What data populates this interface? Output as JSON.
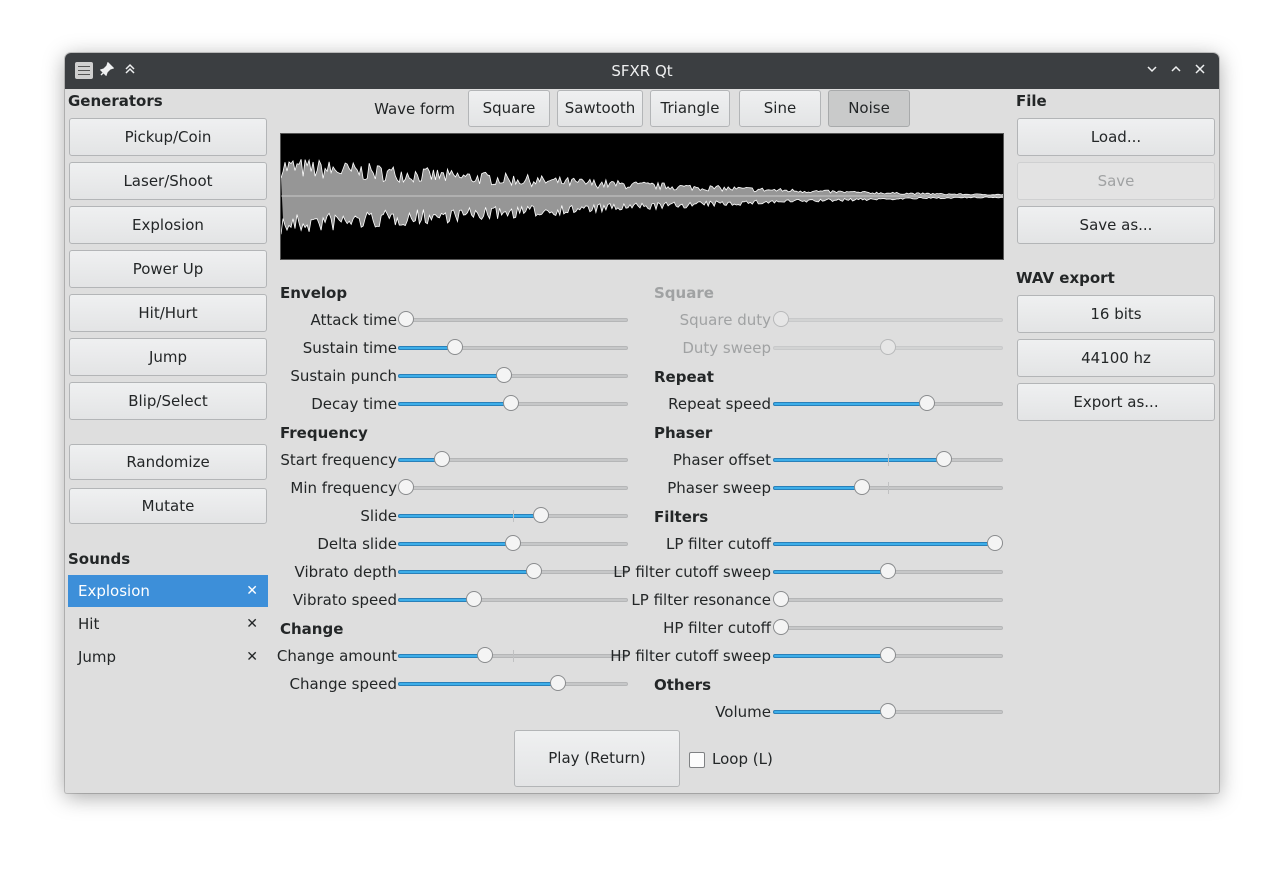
{
  "window": {
    "title": "SFXR Qt"
  },
  "generators": {
    "header": "Generators",
    "buttons": [
      "Pickup/Coin",
      "Laser/Shoot",
      "Explosion",
      "Power Up",
      "Hit/Hurt",
      "Jump",
      "Blip/Select"
    ],
    "randomize": "Randomize",
    "mutate": "Mutate"
  },
  "sounds": {
    "header": "Sounds",
    "items": [
      {
        "name": "Explosion",
        "selected": true
      },
      {
        "name": "Hit",
        "selected": false
      },
      {
        "name": "Jump",
        "selected": false
      }
    ],
    "remove_glyph": "✕"
  },
  "waveform": {
    "label": "Wave form",
    "options": [
      "Square",
      "Sawtooth",
      "Triangle",
      "Sine",
      "Noise"
    ],
    "selected": "Noise"
  },
  "envelop": {
    "header": "Envelop",
    "sliders": [
      {
        "label": "Attack time",
        "value": 0.0
      },
      {
        "label": "Sustain time",
        "value": 0.23
      },
      {
        "label": "Sustain punch",
        "value": 0.46
      },
      {
        "label": "Decay time",
        "value": 0.49
      }
    ]
  },
  "frequency": {
    "header": "Frequency",
    "sliders": [
      {
        "label": "Start frequency",
        "value": 0.17
      },
      {
        "label": "Min frequency",
        "value": 0.0
      },
      {
        "label": "Slide",
        "value": 0.63,
        "center_tick": true
      },
      {
        "label": "Delta slide",
        "value": 0.5,
        "center_tick": true
      },
      {
        "label": "Vibrato depth",
        "value": 0.6
      },
      {
        "label": "Vibrato speed",
        "value": 0.32
      }
    ]
  },
  "change": {
    "header": "Change",
    "sliders": [
      {
        "label": "Change amount",
        "value": 0.37,
        "center_tick": true
      },
      {
        "label": "Change speed",
        "value": 0.71
      }
    ]
  },
  "square": {
    "header": "Square",
    "disabled": true,
    "sliders": [
      {
        "label": "Square duty",
        "value": 0.0
      },
      {
        "label": "Duty sweep",
        "value": 0.5
      }
    ]
  },
  "repeat": {
    "header": "Repeat",
    "sliders": [
      {
        "label": "Repeat speed",
        "value": 0.68
      }
    ]
  },
  "phaser": {
    "header": "Phaser",
    "sliders": [
      {
        "label": "Phaser offset",
        "value": 0.76,
        "center_tick": true
      },
      {
        "label": "Phaser sweep",
        "value": 0.38,
        "center_tick": true
      }
    ]
  },
  "filters": {
    "header": "Filters",
    "sliders": [
      {
        "label": "LP filter cutoff",
        "value": 1.0
      },
      {
        "label": "LP filter cutoff sweep",
        "value": 0.5,
        "center_tick": true
      },
      {
        "label": "LP filter resonance",
        "value": 0.0
      },
      {
        "label": "HP filter cutoff",
        "value": 0.0
      },
      {
        "label": "HP filter cutoff sweep",
        "value": 0.5,
        "center_tick": true
      }
    ]
  },
  "others": {
    "header": "Others",
    "sliders": [
      {
        "label": "Volume",
        "value": 0.5
      }
    ]
  },
  "play": {
    "label": "Play (Return)",
    "loop_label": "Loop (L)",
    "loop_checked": false
  },
  "file": {
    "header": "File",
    "load": "Load...",
    "save": "Save",
    "save_disabled": true,
    "save_as": "Save as..."
  },
  "wav_export": {
    "header": "WAV export",
    "bits": "16 bits",
    "rate": "44100 hz",
    "export": "Export as..."
  },
  "colors": {
    "accent": "#3daee9",
    "selection": "#3d8fd9",
    "titlebar": "#3b3e41",
    "waveform_line": "#ffffff",
    "waveform_fill": "#969696"
  }
}
